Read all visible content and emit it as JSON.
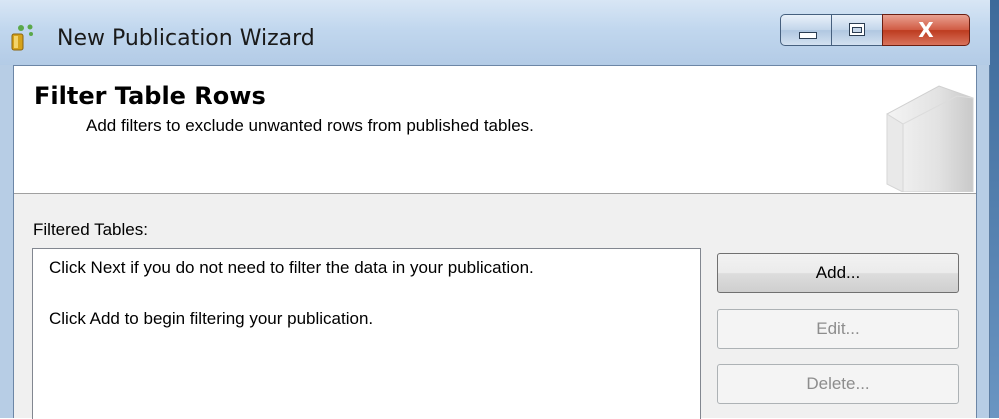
{
  "window": {
    "title": "New Publication Wizard",
    "close_glyph": "X",
    "controls": [
      "minimize-icon",
      "maximize-icon",
      "close-icon"
    ]
  },
  "header": {
    "title": "Filter Table Rows",
    "subtitle": "Add filters to exclude unwanted rows from published tables.",
    "icon": "book-icon"
  },
  "filtered_tables": {
    "label": "Filtered Tables:",
    "messages": [
      "Click Next if you do not need to filter the data in your publication.",
      "Click Add to begin filtering your publication."
    ]
  },
  "buttons": {
    "add": "Add...",
    "edit": "Edit...",
    "delete": "Delete..."
  },
  "colors": {
    "titlebar": "#c1d7ee",
    "close_button": "#c9452b",
    "client_background": "#f0f0f0",
    "disabled_text": "#8d8d8d"
  }
}
